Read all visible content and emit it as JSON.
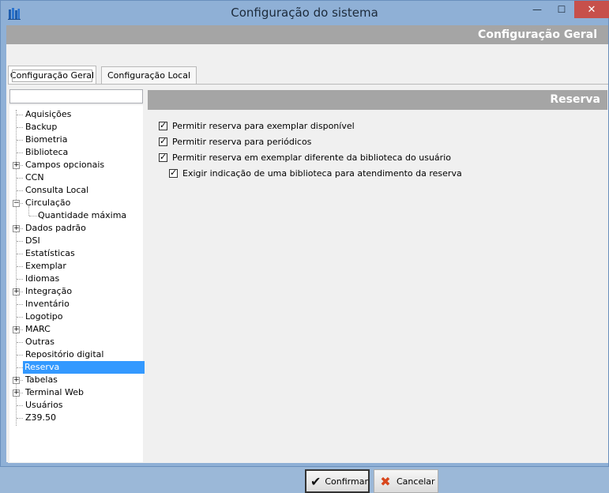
{
  "window": {
    "title": "Configuração do sistema",
    "minimize": "—",
    "maximize": "☐",
    "close": "✕"
  },
  "header": {
    "title": "Configuração Geral"
  },
  "tabs": [
    {
      "label": "Configuração Geral",
      "active": true
    },
    {
      "label": "Configuração Local",
      "active": false
    }
  ],
  "tree": {
    "filter_value": "",
    "items": [
      {
        "label": "Aquisições",
        "expander": "",
        "level": 0
      },
      {
        "label": "Backup",
        "expander": "",
        "level": 0
      },
      {
        "label": "Biometria",
        "expander": "",
        "level": 0
      },
      {
        "label": "Biblioteca",
        "expander": "",
        "level": 0
      },
      {
        "label": "Campos opcionais",
        "expander": "+",
        "level": 0
      },
      {
        "label": "CCN",
        "expander": "",
        "level": 0
      },
      {
        "label": "Consulta Local",
        "expander": "",
        "level": 0
      },
      {
        "label": "Circulação",
        "expander": "−",
        "level": 0
      },
      {
        "label": "Quantidade máxima",
        "expander": "",
        "level": 1
      },
      {
        "label": "Dados padrão",
        "expander": "+",
        "level": 0
      },
      {
        "label": "DSI",
        "expander": "",
        "level": 0
      },
      {
        "label": "Estatísticas",
        "expander": "",
        "level": 0
      },
      {
        "label": "Exemplar",
        "expander": "",
        "level": 0
      },
      {
        "label": "Idiomas",
        "expander": "",
        "level": 0
      },
      {
        "label": "Integração",
        "expander": "+",
        "level": 0
      },
      {
        "label": "Inventário",
        "expander": "",
        "level": 0
      },
      {
        "label": "Logotipo",
        "expander": "",
        "level": 0
      },
      {
        "label": "MARC",
        "expander": "+",
        "level": 0
      },
      {
        "label": "Outras",
        "expander": "",
        "level": 0
      },
      {
        "label": "Repositório digital",
        "expander": "",
        "level": 0
      },
      {
        "label": "Reserva",
        "expander": "",
        "level": 0,
        "selected": true
      },
      {
        "label": "Tabelas",
        "expander": "+",
        "level": 0
      },
      {
        "label": "Terminal Web",
        "expander": "+",
        "level": 0
      },
      {
        "label": "Usuários",
        "expander": "",
        "level": 0
      },
      {
        "label": "Z39.50",
        "expander": "",
        "level": 0
      }
    ]
  },
  "content": {
    "title": "Reserva",
    "options": [
      {
        "label": "Permitir reserva para exemplar disponível",
        "checked": true,
        "indent": 0
      },
      {
        "label": "Permitir reserva para periódicos",
        "checked": true,
        "indent": 0
      },
      {
        "label": "Permitir reserva em exemplar diferente da biblioteca do usuário",
        "checked": true,
        "indent": 0
      },
      {
        "label": "Exigir indicação de uma biblioteca para atendimento da reserva",
        "checked": true,
        "indent": 1
      }
    ]
  },
  "buttons": {
    "confirm": "Confirmar",
    "cancel": "Cancelar"
  }
}
